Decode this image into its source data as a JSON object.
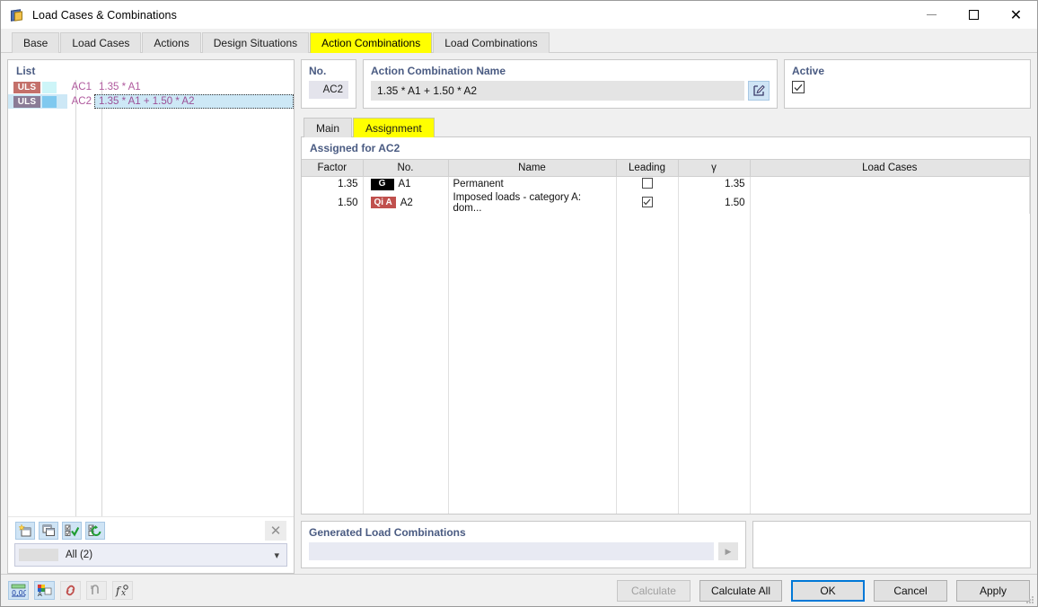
{
  "window": {
    "title": "Load Cases & Combinations",
    "icon": "load-cases-icon",
    "minimize": "minimize",
    "maximize": "maximize",
    "close": "close"
  },
  "tabs": [
    {
      "label": "Base",
      "active": false
    },
    {
      "label": "Load Cases",
      "active": false
    },
    {
      "label": "Actions",
      "active": false
    },
    {
      "label": "Design Situations",
      "active": false
    },
    {
      "label": "Action Combinations",
      "active": true
    },
    {
      "label": "Load Combinations",
      "active": false
    }
  ],
  "list_panel": {
    "title": "List",
    "rows": [
      {
        "badge": "ULS",
        "badge_color": "#c4706a",
        "swatch_color": "#cdf5f8",
        "no": "AC1",
        "expression": "1.35 * A1",
        "selected": false
      },
      {
        "badge": "ULS",
        "badge_color": "#8a7b96",
        "swatch_color": "#7fc9ef",
        "no": "AC2",
        "expression": "1.35 * A1 + 1.50 * A2",
        "selected": true
      }
    ],
    "toolbar": [
      {
        "name": "new-icon",
        "label": "New"
      },
      {
        "name": "copy-icon",
        "label": "Copy"
      },
      {
        "name": "select-all-icon",
        "label": "Select All"
      },
      {
        "name": "invert-selection-icon",
        "label": "Invert Selection"
      },
      {
        "name": "delete-icon",
        "label": "Delete"
      }
    ],
    "filter": {
      "label": "All (2)",
      "chevron": "chevron-down-icon"
    }
  },
  "detail": {
    "no": {
      "label": "No.",
      "value": "AC2"
    },
    "name": {
      "label": "Action Combination Name",
      "value": "1.35 * A1 + 1.50 * A2",
      "edit_icon": "edit-icon"
    },
    "active": {
      "label": "Active",
      "checked": true
    }
  },
  "inner_tabs": [
    {
      "label": "Main",
      "active": false
    },
    {
      "label": "Assignment",
      "active": true
    }
  ],
  "assignment": {
    "title": "Assigned for AC2",
    "columns": [
      "Factor",
      "No.",
      "Name",
      "Leading",
      "γ",
      "Load Cases"
    ],
    "rows": [
      {
        "factor": "1.35",
        "chip": "G",
        "chip_color": "#000000",
        "no": "A1",
        "name": "Permanent",
        "leading": false,
        "gamma": "1.35",
        "load_cases": ""
      },
      {
        "factor": "1.50",
        "chip": "Qi A",
        "chip_color": "#c0504d",
        "no": "A2",
        "name": "Imposed loads - category A: dom...",
        "leading": true,
        "gamma": "1.50",
        "load_cases": ""
      }
    ]
  },
  "generated": {
    "label": "Generated Load Combinations",
    "value": "",
    "play_icon": "play-icon"
  },
  "footer": {
    "icons": [
      {
        "name": "decimal-places-icon",
        "label": "0,00"
      },
      {
        "name": "units-icon",
        "label": "Units"
      },
      {
        "name": "link-icon",
        "label": "Link"
      },
      {
        "name": "relations-icon",
        "label": "Relations"
      },
      {
        "name": "formula-icon",
        "label": "Formula"
      }
    ],
    "buttons": [
      {
        "label": "Calculate",
        "state": "disabled"
      },
      {
        "label": "Calculate All",
        "state": "normal"
      },
      {
        "label": "OK",
        "state": "primary"
      },
      {
        "label": "Cancel",
        "state": "normal"
      },
      {
        "label": "Apply",
        "state": "normal"
      }
    ]
  }
}
